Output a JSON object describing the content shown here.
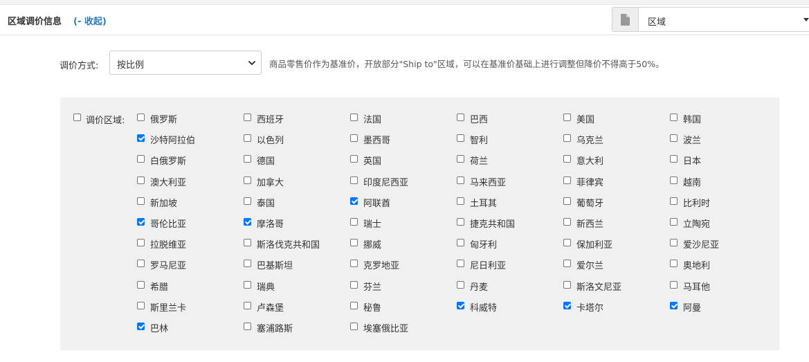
{
  "header": {
    "title": "区域调价信息",
    "collapse_link": "(- 收起)",
    "region_select": {
      "value": "区域",
      "icon": "document-icon"
    }
  },
  "pricing": {
    "method_label": "调价方式:",
    "method_value": "按比例",
    "note": "商品零售价作为基准价，开放部分\"Ship to\"区域，可以在基准价基础上进行调整但降价不得高于50%。"
  },
  "regions": {
    "label": "调价区域:",
    "select_all_checked": false,
    "countries": [
      {
        "name": "俄罗斯",
        "checked": false
      },
      {
        "name": "西班牙",
        "checked": false
      },
      {
        "name": "法国",
        "checked": false
      },
      {
        "name": "巴西",
        "checked": false
      },
      {
        "name": "美国",
        "checked": false
      },
      {
        "name": "韩国",
        "checked": false
      },
      {
        "name": "沙特阿拉伯",
        "checked": true
      },
      {
        "name": "以色列",
        "checked": false
      },
      {
        "name": "墨西哥",
        "checked": false
      },
      {
        "name": "智利",
        "checked": false
      },
      {
        "name": "乌克兰",
        "checked": false
      },
      {
        "name": "波兰",
        "checked": false
      },
      {
        "name": "白俄罗斯",
        "checked": false
      },
      {
        "name": "德国",
        "checked": false
      },
      {
        "name": "英国",
        "checked": false
      },
      {
        "name": "荷兰",
        "checked": false
      },
      {
        "name": "意大利",
        "checked": false
      },
      {
        "name": "日本",
        "checked": false
      },
      {
        "name": "澳大利亚",
        "checked": false
      },
      {
        "name": "加拿大",
        "checked": false
      },
      {
        "name": "印度尼西亚",
        "checked": false
      },
      {
        "name": "马来西亚",
        "checked": false
      },
      {
        "name": "菲律宾",
        "checked": false
      },
      {
        "name": "越南",
        "checked": false
      },
      {
        "name": "新加坡",
        "checked": false
      },
      {
        "name": "泰国",
        "checked": false
      },
      {
        "name": "阿联酋",
        "checked": true
      },
      {
        "name": "土耳其",
        "checked": false
      },
      {
        "name": "葡萄牙",
        "checked": false
      },
      {
        "name": "比利时",
        "checked": false
      },
      {
        "name": "哥伦比亚",
        "checked": true
      },
      {
        "name": "摩洛哥",
        "checked": true
      },
      {
        "name": "瑞士",
        "checked": false
      },
      {
        "name": "捷克共和国",
        "checked": false
      },
      {
        "name": "新西兰",
        "checked": false
      },
      {
        "name": "立陶宛",
        "checked": false
      },
      {
        "name": "拉脱维亚",
        "checked": false
      },
      {
        "name": "斯洛伐克共和国",
        "checked": false
      },
      {
        "name": "挪威",
        "checked": false
      },
      {
        "name": "匈牙利",
        "checked": false
      },
      {
        "name": "保加利亚",
        "checked": false
      },
      {
        "name": "爱沙尼亚",
        "checked": false
      },
      {
        "name": "罗马尼亚",
        "checked": false
      },
      {
        "name": "巴基斯坦",
        "checked": false
      },
      {
        "name": "克罗地亚",
        "checked": false
      },
      {
        "name": "尼日利亚",
        "checked": false
      },
      {
        "name": "爱尔兰",
        "checked": false
      },
      {
        "name": "奥地利",
        "checked": false
      },
      {
        "name": "希腊",
        "checked": false
      },
      {
        "name": "瑞典",
        "checked": false
      },
      {
        "name": "芬兰",
        "checked": false
      },
      {
        "name": "丹麦",
        "checked": false
      },
      {
        "name": "斯洛文尼亚",
        "checked": false
      },
      {
        "name": "马耳他",
        "checked": false
      },
      {
        "name": "斯里兰卡",
        "checked": false
      },
      {
        "name": "卢森堡",
        "checked": false
      },
      {
        "name": "秘鲁",
        "checked": false
      },
      {
        "name": "科威特",
        "checked": true
      },
      {
        "name": "卡塔尔",
        "checked": true
      },
      {
        "name": "阿曼",
        "checked": true
      },
      {
        "name": "巴林",
        "checked": true
      },
      {
        "name": "塞浦路斯",
        "checked": false
      },
      {
        "name": "埃塞俄比亚",
        "checked": false
      }
    ]
  }
}
